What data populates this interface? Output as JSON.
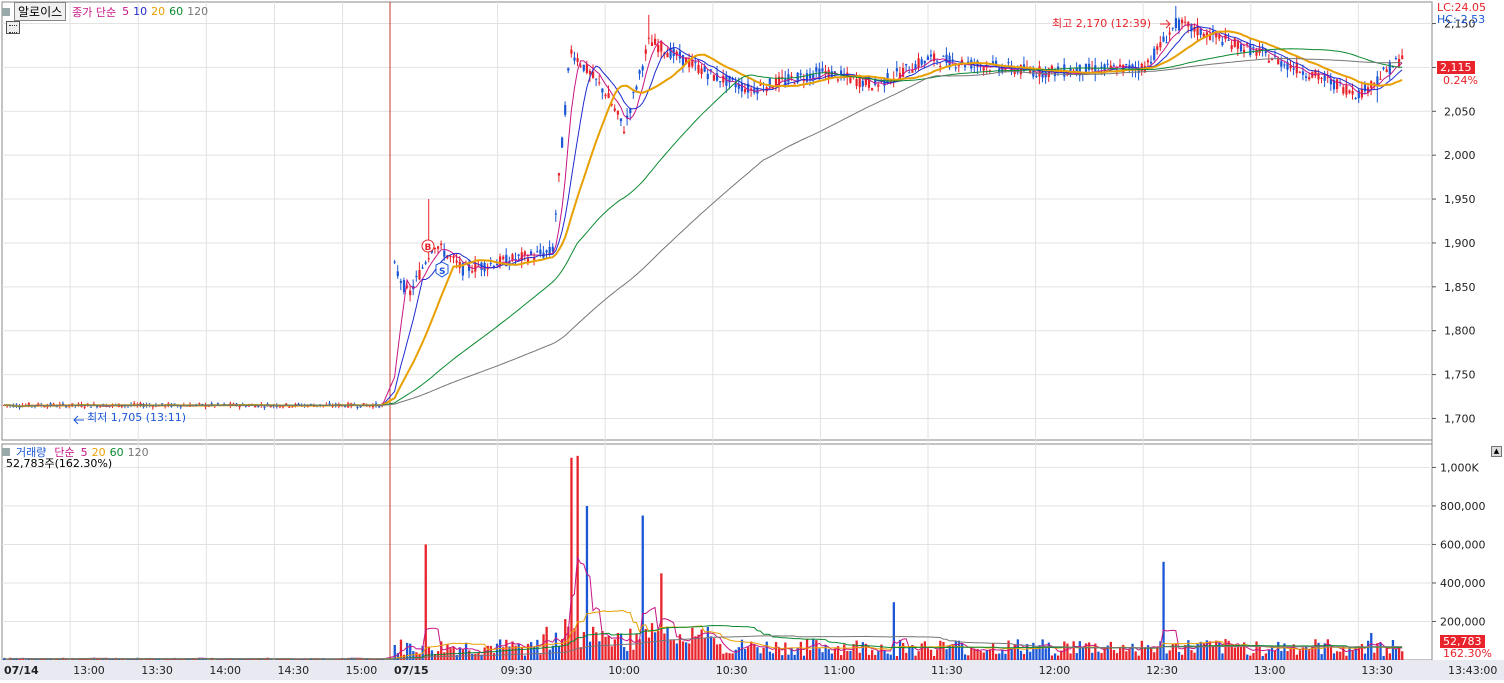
{
  "price_panel": {
    "stock_name": "알로이스",
    "indicator_label": "종가 단순",
    "ma_periods": [
      {
        "label": "5",
        "color": "#c71585"
      },
      {
        "label": "10",
        "color": "#1f2bd0"
      },
      {
        "label": "20",
        "color": "#e8a000"
      },
      {
        "label": "60",
        "color": "#0b8a2f"
      },
      {
        "label": "120",
        "color": "#777777"
      }
    ],
    "lc_label": "LC:24.05",
    "hc_label": "HC:-2.53",
    "current_price": "2,115",
    "change_pct": "0.24%",
    "high_annotation": "최고 2,170 (12:39)",
    "low_annotation": "최저 1,705 (13:11)",
    "buy_marker": "B",
    "sell_marker": "S",
    "y_ticks": [
      "2,150",
      "2,100",
      "2,050",
      "2,000",
      "1,950",
      "1,900",
      "1,850",
      "1,800",
      "1,750",
      "1,700"
    ]
  },
  "volume_panel": {
    "title": "거래량",
    "indicator_label": "단순",
    "ma_periods": [
      {
        "label": "5",
        "color": "#c71585"
      },
      {
        "label": "20",
        "color": "#e8a000"
      },
      {
        "label": "60",
        "color": "#0b8a2f"
      },
      {
        "label": "120",
        "color": "#777777"
      }
    ],
    "volume_text": "52,783주(162.30%)",
    "current_volume": "52,783",
    "volume_pct": "162.30%",
    "y_ticks": [
      "1,000K",
      "800,000",
      "600,000",
      "400,000",
      "200,000"
    ]
  },
  "time_axis": {
    "labels": [
      "07/14",
      "13:00",
      "13:30",
      "14:00",
      "14:30",
      "15:00",
      "07/15",
      "09:30",
      "10:00",
      "10:30",
      "11:00",
      "11:30",
      "12:00",
      "12:30",
      "13:00",
      "13:30",
      "13:43:00"
    ]
  },
  "colors": {
    "up": "#e8232b",
    "down": "#1a56d6",
    "grid": "#e2e2e2",
    "session_divider": "#c0392b"
  },
  "chart_data": {
    "type": "candlestick",
    "price_ylim": [
      1680,
      2170
    ],
    "volume_ylim": [
      0,
      1080000
    ],
    "session_breaks": [
      "07/15"
    ],
    "price_keypoints": [
      {
        "time": "07/14 12:30",
        "price": 1715
      },
      {
        "time": "07/14 15:20",
        "price": 1715
      },
      {
        "time": "07/15 09:00",
        "price": 1880
      },
      {
        "time": "07/15 09:05",
        "price": 1840
      },
      {
        "time": "07/15 09:12",
        "price": 1900
      },
      {
        "time": "07/15 09:20",
        "price": 1870
      },
      {
        "time": "07/15 09:45",
        "price": 1890
      },
      {
        "time": "07/15 09:50",
        "price": 2120
      },
      {
        "time": "07/15 10:00",
        "price": 2070
      },
      {
        "time": "07/15 10:05",
        "price": 2030
      },
      {
        "time": "07/15 10:12",
        "price": 2130
      },
      {
        "time": "07/15 10:30",
        "price": 2090
      },
      {
        "time": "07/15 10:40",
        "price": 2075
      },
      {
        "time": "07/15 11:00",
        "price": 2095
      },
      {
        "time": "07/15 11:15",
        "price": 2080
      },
      {
        "time": "07/15 11:30",
        "price": 2110
      },
      {
        "time": "07/15 12:00",
        "price": 2095
      },
      {
        "time": "07/15 12:30",
        "price": 2100
      },
      {
        "time": "07/15 12:39",
        "price": 2150
      },
      {
        "time": "07/15 13:00",
        "price": 2120
      },
      {
        "time": "07/15 13:30",
        "price": 2070
      },
      {
        "time": "07/15 13:43",
        "price": 2115
      }
    ],
    "volume_peaks": [
      {
        "time": "07/15 09:00",
        "value": 160000
      },
      {
        "time": "07/15 09:10",
        "value": 600000
      },
      {
        "time": "07/15 09:50",
        "value": 1050000
      },
      {
        "time": "07/15 09:52",
        "value": 1060000
      },
      {
        "time": "07/15 09:55",
        "value": 800000
      },
      {
        "time": "07/15 10:10",
        "value": 750000
      },
      {
        "time": "07/15 10:15",
        "value": 450000
      },
      {
        "time": "07/15 11:20",
        "value": 300000
      },
      {
        "time": "07/15 12:35",
        "value": 510000
      },
      {
        "time": "07/15 13:33",
        "value": 140000
      }
    ]
  }
}
